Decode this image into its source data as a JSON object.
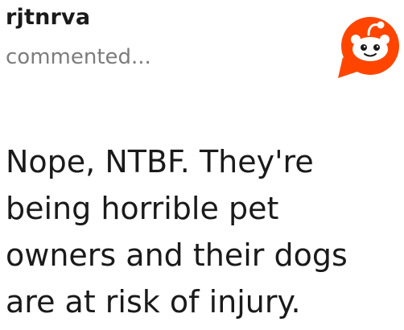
{
  "comment": {
    "author": "rjtnrva",
    "action_text": "commented...",
    "body": "Nope, NTBF. They're being horrible pet owners and their dogs are at risk of injury."
  },
  "branding": {
    "logo_icon": "reddit-snoo-icon",
    "accent_color": "#ff4500"
  }
}
